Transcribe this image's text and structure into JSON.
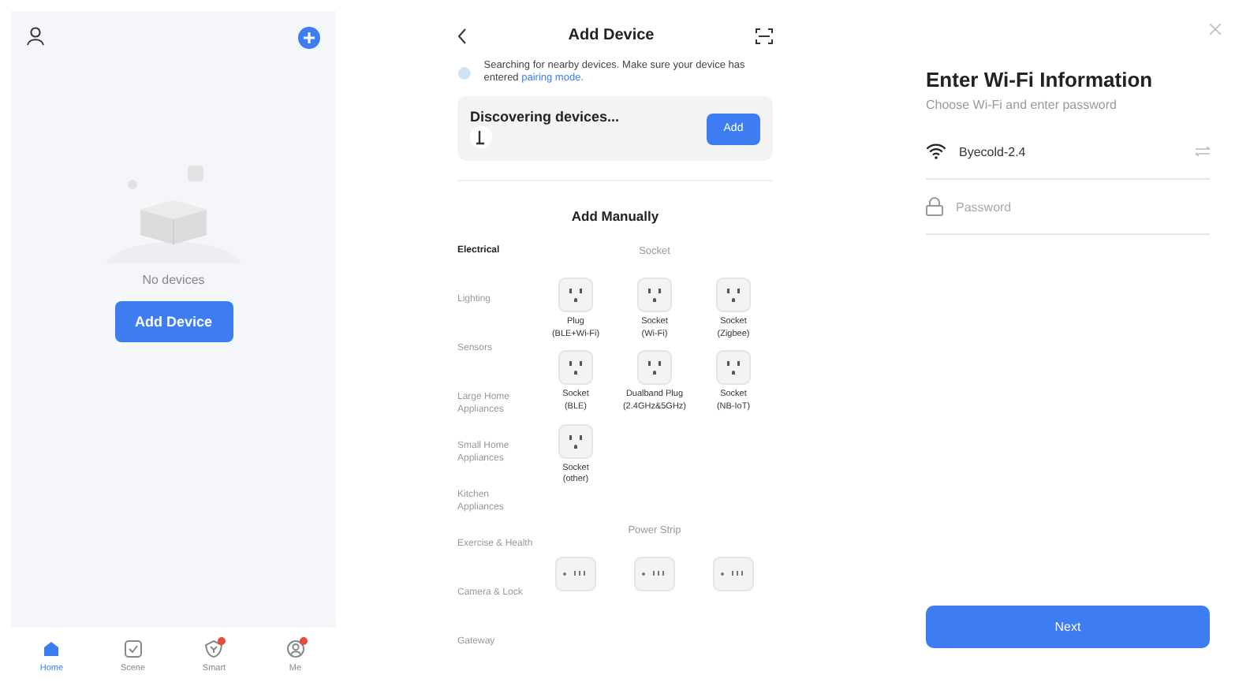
{
  "home": {
    "empty_text": "No devices",
    "add_button": "Add Device",
    "nav": [
      {
        "label": "Home",
        "selected": true,
        "badge": false
      },
      {
        "label": "Scene",
        "selected": false,
        "badge": false
      },
      {
        "label": "Smart",
        "selected": false,
        "badge": true
      },
      {
        "label": "Me",
        "selected": false,
        "badge": true
      }
    ]
  },
  "add_device": {
    "title": "Add Device",
    "search_note": "Searching for nearby devices. Make sure your device has entered",
    "search_link": "pairing mode.",
    "discovering": "Discovering devices...",
    "add_button": "Add",
    "manual_title": "Add Manually",
    "categories": [
      {
        "label": "Electrical",
        "selected": true
      },
      {
        "label": "Lighting",
        "selected": false
      },
      {
        "label": "Sensors",
        "selected": false
      },
      {
        "label": "Large Home Appliances",
        "selected": false
      },
      {
        "label": "Small Home Appliances",
        "selected": false
      },
      {
        "label": "Kitchen Appliances",
        "selected": false
      },
      {
        "label": "Exercise & Health",
        "selected": false
      },
      {
        "label": "Camera & Lock",
        "selected": false
      },
      {
        "label": "Gateway",
        "selected": false
      }
    ],
    "sections": [
      {
        "title": "Socket",
        "products": [
          {
            "kind": "socket",
            "name": "Plug",
            "detail": "(BLE+Wi-Fi)"
          },
          {
            "kind": "socket",
            "name": "Socket",
            "detail": "(Wi-Fi)"
          },
          {
            "kind": "socket",
            "name": "Socket",
            "detail": "(Zigbee)"
          },
          {
            "kind": "socket",
            "name": "Socket",
            "detail": "(BLE)"
          },
          {
            "kind": "socket",
            "name": "Dualband Plug",
            "detail": "(2.4GHz&5GHz)"
          },
          {
            "kind": "socket",
            "name": "Socket",
            "detail": "(NB-IoT)"
          },
          {
            "kind": "socket",
            "name": "Socket",
            "detail": "(other)"
          }
        ]
      },
      {
        "title": "Power Strip",
        "products": [
          {
            "kind": "strip"
          },
          {
            "kind": "strip"
          },
          {
            "kind": "strip"
          }
        ]
      }
    ]
  },
  "wifi": {
    "title": "Enter Wi-Fi Information",
    "subtitle": "Choose Wi-Fi and enter password",
    "network": "Byecold-2.4",
    "password_placeholder": "Password",
    "next_button": "Next"
  }
}
